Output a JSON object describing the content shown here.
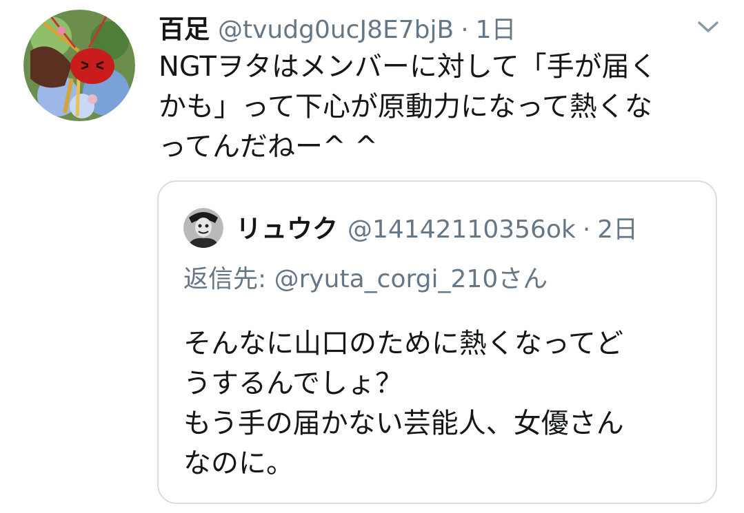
{
  "tweet": {
    "avatar_icon": "centipede-avatar-icon",
    "display_name": "百足",
    "handle": "@tvudg0ucJ8E7bjB",
    "separator": "·",
    "time": "1日",
    "menu_icon": "chevron-down-icon",
    "text": "NGTヲタはメンバーに対して「手が届く\nかも」って下心が原動力になって熱くな\nってんだねー^ ^"
  },
  "quote": {
    "avatar_icon": "ryuk-avatar-icon",
    "display_name": "リュウク",
    "handle": "@14142110356ok",
    "separator": "·",
    "time": "2日",
    "reply_prefix": "返信先: ",
    "reply_mention": "@ryuta_corgi_210さん",
    "text": "そんなに山口のために熱くなってど\nうするんでしょ？\nもう手の届かない芸能人、女優さん\nなのに。"
  },
  "colors": {
    "text_primary": "#14171a",
    "text_secondary": "#657786",
    "border": "#d8dde1",
    "background": "#ffffff"
  }
}
